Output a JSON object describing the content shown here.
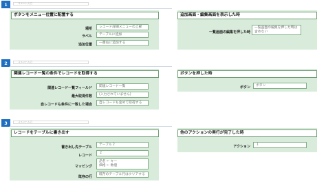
{
  "comment_placeholder": "コメント入力",
  "steps": [
    {
      "number": "1",
      "action_title": "ボタンをメニュー位置に配置する",
      "action_rows": [
        {
          "label": "場所",
          "value": "レコード詳細メニューの上部"
        },
        {
          "label": "ラベル",
          "value": "テーブルに追加"
        },
        {
          "label": "追加位置",
          "value": "一番右に追加する"
        }
      ],
      "trigger_title": "追加画面・編集画面を表示した時",
      "trigger_rows": [
        {
          "label": "一覧画面の編集を押した時",
          "value": "一覧画面の編集を押した時は含めない"
        }
      ]
    },
    {
      "number": "2",
      "action_title": "関連レコード一覧の条件でレコードを取得する",
      "action_rows": [
        {
          "label": "関連レコード一覧フィールド",
          "value": "関連レコード一覧"
        },
        {
          "label": "最大取得件数",
          "value": "(入力されていません)"
        },
        {
          "label": "自レコードも条件に一致した場合",
          "value": "自レコードも含めて取得する"
        }
      ],
      "trigger_title": "ボタンを押した時",
      "trigger_rows": [
        {
          "label": "ボタン",
          "value": "ボタン"
        }
      ]
    },
    {
      "number": "3",
      "action_title": "レコードをテーブルに書き出す",
      "action_rows": [
        {
          "label": "書き出し先テーブル",
          "value": "テーブル２"
        },
        {
          "label": "レコード",
          "value": "２"
        },
        {
          "label": "マッピング",
          "value": "品名 ← キー\n価格 ← 数値"
        },
        {
          "label": "既存の行",
          "value": "既存のテーブル行はクリアする"
        }
      ],
      "trigger_title": "他のアクションの実行が完了した時",
      "trigger_rows": [
        {
          "label": "アクション",
          "value": "１"
        }
      ]
    }
  ]
}
